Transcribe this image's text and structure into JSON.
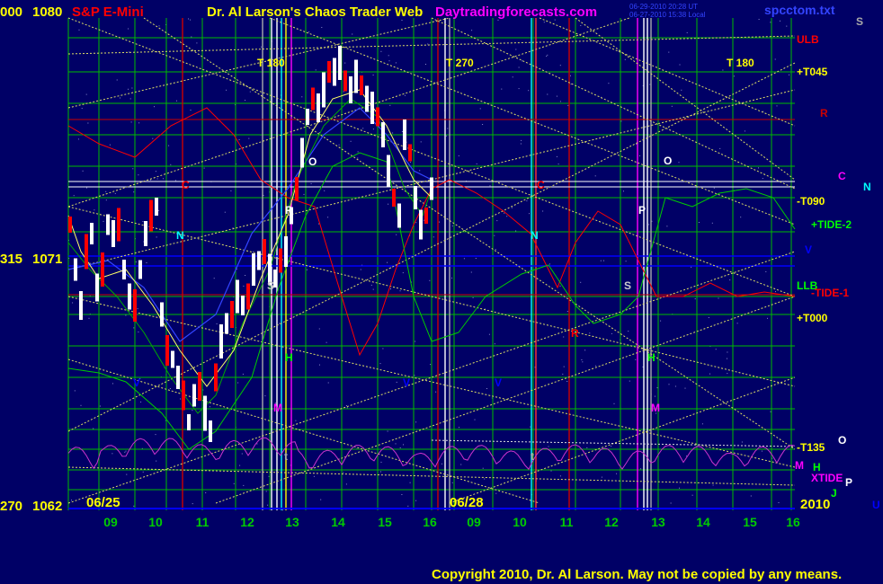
{
  "header": {
    "left_price_a": "000",
    "left_price_b": "1080",
    "instrument": "S&P E-Mini",
    "title": "Dr. Al Larson's Chaos Trader Web",
    "site": "Daytradingforecasts.com",
    "stamp_1": "06-29-2010 20:28 UT",
    "stamp_2": "06-27-2010 15:38 Local",
    "filename": "spcctom.txt",
    "corner_letter": "S"
  },
  "price_labels": [
    {
      "deg": "315",
      "price": "1071"
    },
    {
      "deg": "270",
      "price": "1062"
    }
  ],
  "date_labels": [
    "06/25",
    "06/28"
  ],
  "year_label": "2010",
  "footer": {
    "copyright": "Copyright 2010, Dr. Al Larson. May not be copied by any means."
  },
  "colors": {
    "background": "#000066",
    "green_grid": "#00bb00",
    "yellow_text": "#ffff00",
    "red": "#ff0000",
    "white": "#ffffff",
    "cyan": "#00ffff",
    "magenta": "#ff00ff",
    "green_line": "#00cc00",
    "blue_line": "#0000ff"
  },
  "chart_data": {
    "type": "line",
    "title": "S&P E-Mini",
    "y_price_levels": [
      1062,
      1071,
      1080
    ],
    "ylim": [
      1062,
      1080
    ],
    "x_ticks": [
      "09",
      "10",
      "11",
      "12",
      "13",
      "14",
      "15",
      "16",
      "09",
      "10",
      "11",
      "12",
      "13",
      "14",
      "15",
      "16"
    ],
    "timing_labels": [
      "T  180",
      "T  270",
      "T  180"
    ],
    "right_labels": [
      {
        "text": "ULB",
        "color": "#ff0000"
      },
      {
        "text": "+T045",
        "color": "#ffff00"
      },
      {
        "text": "R",
        "color": "#cc0000"
      },
      {
        "text": "C",
        "color": "#ff00ff"
      },
      {
        "text": "N",
        "color": "#00ffff"
      },
      {
        "text": "-T090",
        "color": "#ffff00"
      },
      {
        "text": "+TIDE-2",
        "color": "#00ff00"
      },
      {
        "text": "V",
        "color": "#0000ff"
      },
      {
        "text": "LLB",
        "color": "#00ff00"
      },
      {
        "text": "-TIDE-1",
        "color": "#ff0000"
      },
      {
        "text": "+T000",
        "color": "#ffff00"
      },
      {
        "text": "-T135",
        "color": "#ffff00"
      },
      {
        "text": "O",
        "color": "#ffffff"
      },
      {
        "text": "M",
        "color": "#ff00ff"
      },
      {
        "text": "H",
        "color": "#00ff00"
      },
      {
        "text": "XTIDE",
        "color": "#ff00ff"
      },
      {
        "text": "P",
        "color": "#ffffff"
      },
      {
        "text": "J",
        "color": "#00ff00"
      },
      {
        "text": "U",
        "color": "#0000ff"
      }
    ],
    "in_chart_labels": [
      {
        "text": "C",
        "color": "#ff0000"
      },
      {
        "text": "N",
        "color": "#00ffff"
      },
      {
        "text": "O",
        "color": "#ffffff"
      },
      {
        "text": "P",
        "color": "#ffffff"
      },
      {
        "text": "S",
        "color": "#cccccc"
      },
      {
        "text": "H",
        "color": "#00ff00"
      },
      {
        "text": "M",
        "color": "#ff00ff"
      },
      {
        "text": "V",
        "color": "#0000ff"
      },
      {
        "text": "t",
        "color": "#aaaaaa"
      },
      {
        "text": "C",
        "color": "#ff0000"
      },
      {
        "text": "N",
        "color": "#00ffff"
      },
      {
        "text": "R",
        "color": "#ff0000"
      },
      {
        "text": "O",
        "color": "#ffffff"
      },
      {
        "text": "P",
        "color": "#ffffff"
      },
      {
        "text": "S",
        "color": "#cccccc"
      },
      {
        "text": "H",
        "color": "#00ff00"
      },
      {
        "text": "M",
        "color": "#ff00ff"
      },
      {
        "text": "V",
        "color": "#0000ff"
      },
      {
        "text": "t",
        "color": "#aaaaaa"
      },
      {
        "text": "V",
        "color": "#0000ff"
      }
    ]
  }
}
